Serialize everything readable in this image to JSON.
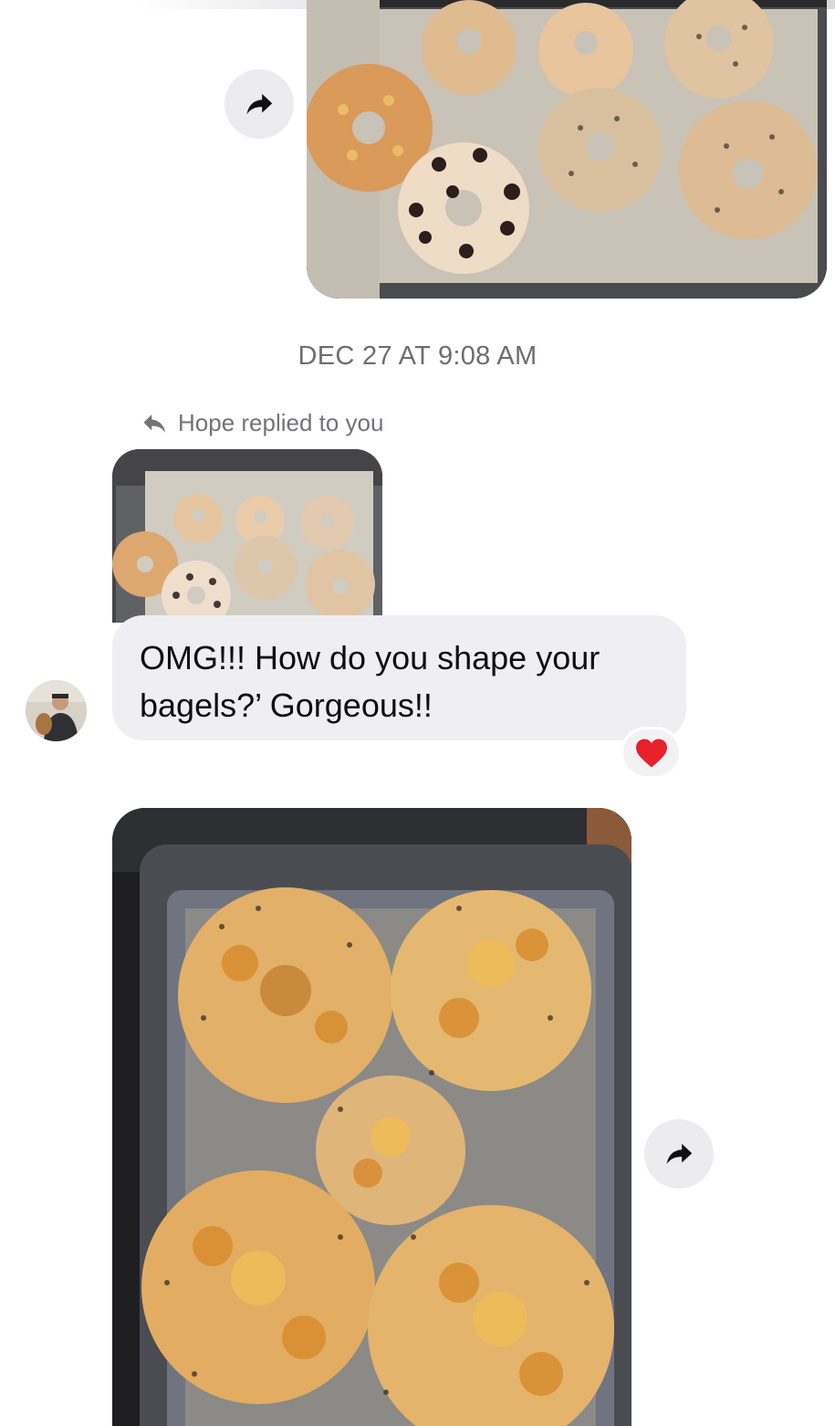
{
  "conversation": {
    "timestamp": "DEC 27 AT 9:08 AM",
    "reply_label": "Hope replied to you",
    "message_text": "OMG!!! How do you shape your bagels?’ Gorgeous!!",
    "reaction_emoji": "heart",
    "colors": {
      "bubble_bg": "#efeff3",
      "meta_text": "#6d6d72",
      "forward_button_bg": "#ececef",
      "heart": "#e8202b"
    }
  },
  "icons": {
    "forward": "share-forward-arrow-icon",
    "reply": "reply-arrow-icon",
    "reaction": "red-heart-icon"
  }
}
